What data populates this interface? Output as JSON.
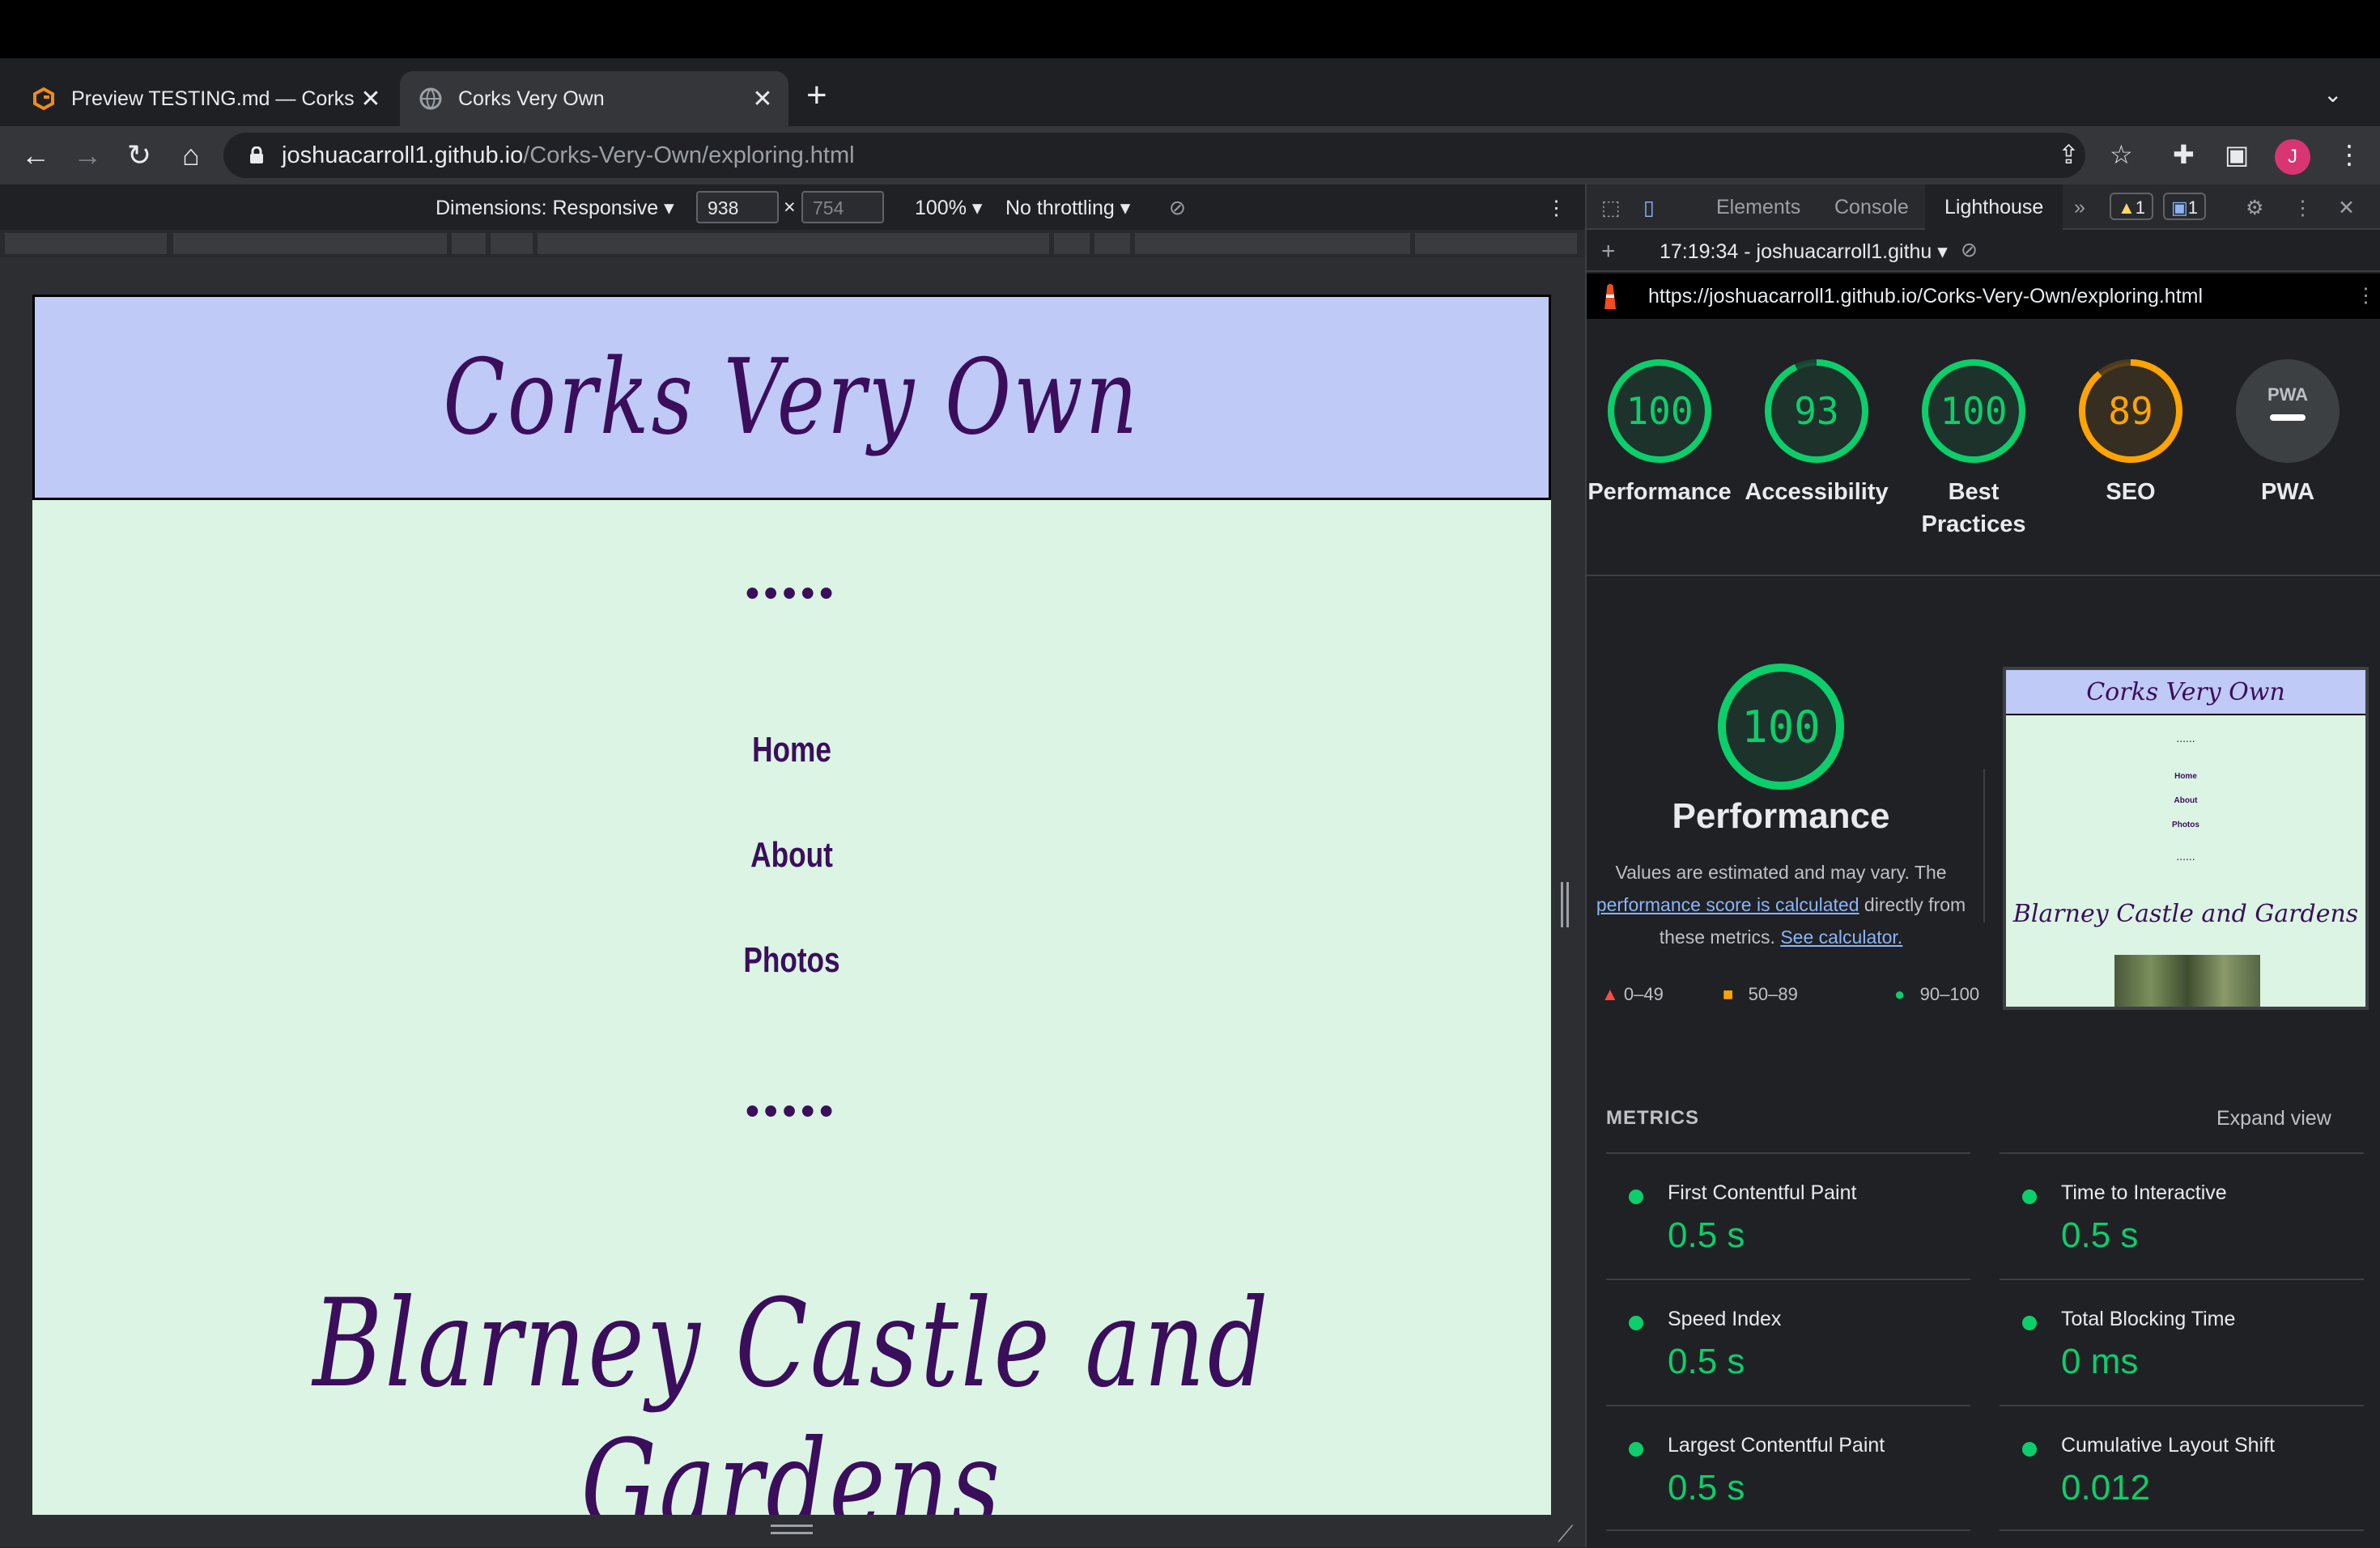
{
  "browser": {
    "tabs": [
      {
        "title": "Preview TESTING.md — Corks-",
        "active": false
      },
      {
        "title": "Corks Very Own",
        "active": true
      }
    ],
    "url_host": "joshuacarroll1.github.io",
    "url_path": "/Corks-Very-Own/exploring.html",
    "avatar_letter": "J"
  },
  "device_toolbar": {
    "dimensions": "Dimensions: Responsive ▾",
    "width": "938",
    "height": "754",
    "zoom": "100% ▾",
    "throttling": "No throttling ▾"
  },
  "site": {
    "title": "Corks Very Own",
    "dots": "•••••",
    "nav": [
      "Home",
      "About",
      "Photos"
    ],
    "heading": "Blarney Castle and Gardens"
  },
  "devtools": {
    "tabs": [
      "Elements",
      "Console",
      "Lighthouse"
    ],
    "more": "»",
    "warnings": "1",
    "messages": "1",
    "report_time": "17:19:34 - joshuacarroll1.githu ▾",
    "report_url": "https://joshuacarroll1.github.io/Corks-Very-Own/exploring.html",
    "scores": [
      {
        "value": "100",
        "label": "Performance",
        "score": 100,
        "color": "#0cce6b"
      },
      {
        "value": "93",
        "label": "Accessibility",
        "score": 93,
        "color": "#0cce6b"
      },
      {
        "value": "100",
        "label": "Best Practices",
        "score": 100,
        "color": "#0cce6b"
      },
      {
        "value": "89",
        "label": "SEO",
        "score": 89,
        "color": "#ffa400"
      },
      {
        "value": "PWA",
        "label": "PWA",
        "score": 0,
        "color": "#9aa0a6"
      }
    ],
    "performance": {
      "score": "100",
      "title": "Performance",
      "desc_1": "Values are estimated and may vary. The",
      "desc_link": "performance score is calculated",
      "desc_2": "directly from",
      "desc_3": "these metrics.",
      "desc_calc": "See calculator."
    },
    "legend": [
      "0–49",
      "50–89",
      "90–100"
    ],
    "thumbnail": {
      "title": "Corks Very Own",
      "dots": "......",
      "nav": [
        "Home",
        "About",
        "Photos"
      ],
      "heading": "Blarney Castle and Gardens"
    },
    "metrics_header": "METRICS",
    "expand_view": "Expand view",
    "metrics": [
      {
        "name": "First Contentful Paint",
        "value": "0.5 s"
      },
      {
        "name": "Time to Interactive",
        "value": "0.5 s"
      },
      {
        "name": "Speed Index",
        "value": "0.5 s"
      },
      {
        "name": "Total Blocking Time",
        "value": "0 ms"
      },
      {
        "name": "Largest Contentful Paint",
        "value": "0.5 s"
      },
      {
        "name": "Cumulative Layout Shift",
        "value": "0.012"
      }
    ]
  }
}
